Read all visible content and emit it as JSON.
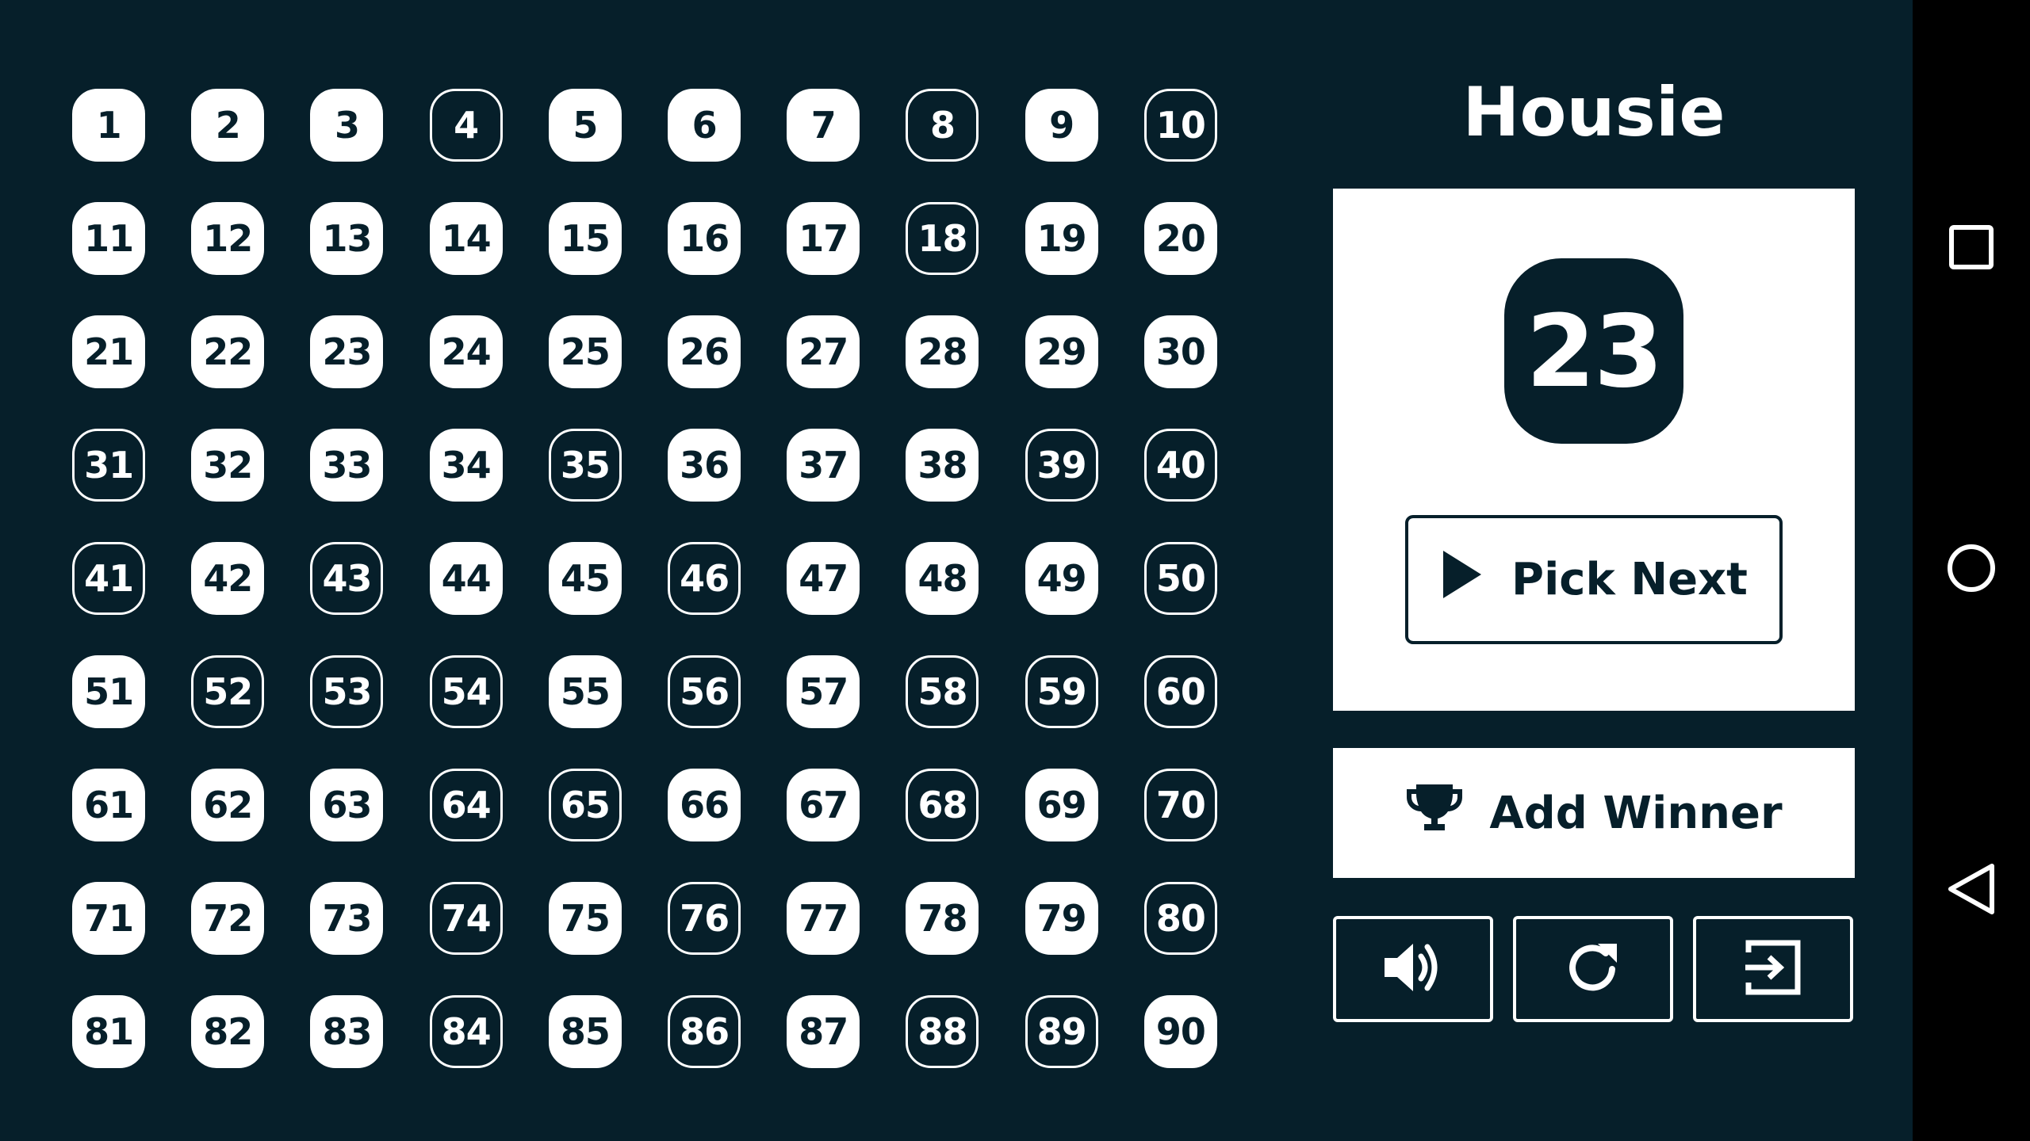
{
  "app": {
    "title": "Housie",
    "current_number": "23",
    "pick_next_label": "Pick Next",
    "add_winner_label": "Add Winner"
  },
  "board": {
    "numbers": [
      {
        "n": "1",
        "called": true
      },
      {
        "n": "2",
        "called": true
      },
      {
        "n": "3",
        "called": true
      },
      {
        "n": "4",
        "called": false
      },
      {
        "n": "5",
        "called": true
      },
      {
        "n": "6",
        "called": true
      },
      {
        "n": "7",
        "called": true
      },
      {
        "n": "8",
        "called": false
      },
      {
        "n": "9",
        "called": true
      },
      {
        "n": "10",
        "called": false
      },
      {
        "n": "11",
        "called": true
      },
      {
        "n": "12",
        "called": true
      },
      {
        "n": "13",
        "called": true
      },
      {
        "n": "14",
        "called": true
      },
      {
        "n": "15",
        "called": true
      },
      {
        "n": "16",
        "called": true
      },
      {
        "n": "17",
        "called": true
      },
      {
        "n": "18",
        "called": false
      },
      {
        "n": "19",
        "called": true
      },
      {
        "n": "20",
        "called": true
      },
      {
        "n": "21",
        "called": true
      },
      {
        "n": "22",
        "called": true
      },
      {
        "n": "23",
        "called": true
      },
      {
        "n": "24",
        "called": true
      },
      {
        "n": "25",
        "called": true
      },
      {
        "n": "26",
        "called": true
      },
      {
        "n": "27",
        "called": true
      },
      {
        "n": "28",
        "called": true
      },
      {
        "n": "29",
        "called": true
      },
      {
        "n": "30",
        "called": true
      },
      {
        "n": "31",
        "called": false
      },
      {
        "n": "32",
        "called": true
      },
      {
        "n": "33",
        "called": true
      },
      {
        "n": "34",
        "called": true
      },
      {
        "n": "35",
        "called": false
      },
      {
        "n": "36",
        "called": true
      },
      {
        "n": "37",
        "called": true
      },
      {
        "n": "38",
        "called": true
      },
      {
        "n": "39",
        "called": false
      },
      {
        "n": "40",
        "called": false
      },
      {
        "n": "41",
        "called": false
      },
      {
        "n": "42",
        "called": true
      },
      {
        "n": "43",
        "called": false
      },
      {
        "n": "44",
        "called": true
      },
      {
        "n": "45",
        "called": true
      },
      {
        "n": "46",
        "called": false
      },
      {
        "n": "47",
        "called": true
      },
      {
        "n": "48",
        "called": true
      },
      {
        "n": "49",
        "called": true
      },
      {
        "n": "50",
        "called": false
      },
      {
        "n": "51",
        "called": true
      },
      {
        "n": "52",
        "called": false
      },
      {
        "n": "53",
        "called": false
      },
      {
        "n": "54",
        "called": false
      },
      {
        "n": "55",
        "called": true
      },
      {
        "n": "56",
        "called": false
      },
      {
        "n": "57",
        "called": true
      },
      {
        "n": "58",
        "called": false
      },
      {
        "n": "59",
        "called": false
      },
      {
        "n": "60",
        "called": false
      },
      {
        "n": "61",
        "called": true
      },
      {
        "n": "62",
        "called": true
      },
      {
        "n": "63",
        "called": true
      },
      {
        "n": "64",
        "called": false
      },
      {
        "n": "65",
        "called": false
      },
      {
        "n": "66",
        "called": true
      },
      {
        "n": "67",
        "called": true
      },
      {
        "n": "68",
        "called": false
      },
      {
        "n": "69",
        "called": true
      },
      {
        "n": "70",
        "called": false
      },
      {
        "n": "71",
        "called": true
      },
      {
        "n": "72",
        "called": true
      },
      {
        "n": "73",
        "called": true
      },
      {
        "n": "74",
        "called": false
      },
      {
        "n": "75",
        "called": true
      },
      {
        "n": "76",
        "called": false
      },
      {
        "n": "77",
        "called": true
      },
      {
        "n": "78",
        "called": true
      },
      {
        "n": "79",
        "called": true
      },
      {
        "n": "80",
        "called": false
      },
      {
        "n": "81",
        "called": true
      },
      {
        "n": "82",
        "called": true
      },
      {
        "n": "83",
        "called": true
      },
      {
        "n": "84",
        "called": false
      },
      {
        "n": "85",
        "called": true
      },
      {
        "n": "86",
        "called": false
      },
      {
        "n": "87",
        "called": true
      },
      {
        "n": "88",
        "called": false
      },
      {
        "n": "89",
        "called": false
      },
      {
        "n": "90",
        "called": true
      }
    ]
  },
  "toolbar": {
    "sound_icon": "volume-icon",
    "reset_icon": "refresh-icon",
    "exit_icon": "exit-icon"
  },
  "nav": {
    "recents_icon": "square-icon",
    "home_icon": "circle-icon",
    "back_icon": "triangle-back-icon"
  },
  "colors": {
    "background": "#061f2a",
    "card": "#ffffff",
    "navbar": "#000000"
  }
}
